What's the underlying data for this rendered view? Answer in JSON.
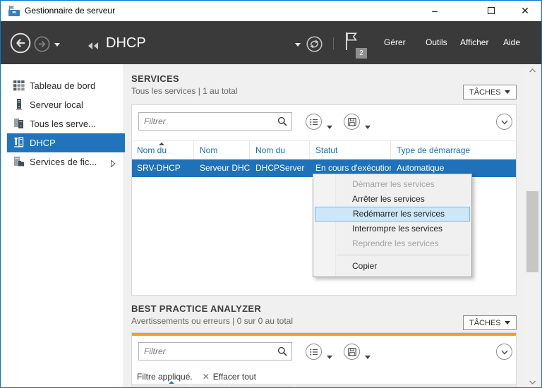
{
  "titlebar": {
    "title": "Gestionnaire de serveur",
    "minimize_glyph": "–",
    "close_glyph": "✕"
  },
  "navbar": {
    "breadcrumb": "DHCP",
    "badge_count": "2",
    "menu_items": [
      "Gérer",
      "Outils",
      "Afficher",
      "Aide"
    ]
  },
  "sidebar": {
    "items": [
      "Tableau de bord",
      "Serveur local",
      "Tous les serve...",
      "DHCP",
      "Services de fic..."
    ]
  },
  "services": {
    "title": "SERVICES",
    "subtitle": "Tous les services | 1 au total",
    "tasks_label": "TÂCHES",
    "filter_placeholder": "Filtrer",
    "columns": [
      "Nom du serveur",
      "Nom complet",
      "Nom du service",
      "Statut",
      "Type de démarrage"
    ],
    "row": {
      "server_name": "SRV-DHCP",
      "full_name": "Serveur DHCP",
      "service_name": "DHCPServer",
      "status": "En cours d'exécution",
      "startup_type": "Automatique"
    }
  },
  "context_menu": {
    "items": [
      {
        "label": "Démarrer les services",
        "state": "disabled"
      },
      {
        "label": "Arrêter les services",
        "state": "enabled"
      },
      {
        "label": "Redémarrer les services",
        "state": "highlighted"
      },
      {
        "label": "Interrompre les services",
        "state": "enabled"
      },
      {
        "label": "Reprendre les services",
        "state": "disabled"
      },
      {
        "label": "Copier",
        "state": "enabled"
      }
    ]
  },
  "bpa": {
    "title": "BEST PRACTICE ANALYZER",
    "subtitle": "Avertissements ou erreurs | 0 sur 0 au total",
    "tasks_label": "TÂCHES",
    "filter_placeholder": "Filtrer",
    "filter_applied": "Filtre appliqué.",
    "clear_icon": "✕",
    "clear_all": "Effacer tout"
  },
  "colors": {
    "accent_border": "#0077d4",
    "navbar_bg": "#3a3a3a",
    "selection_blue": "#2174bc",
    "row_blue": "#1f72b9",
    "header_link_blue": "#1b6ca8",
    "warning_orange": "#efa02c"
  }
}
